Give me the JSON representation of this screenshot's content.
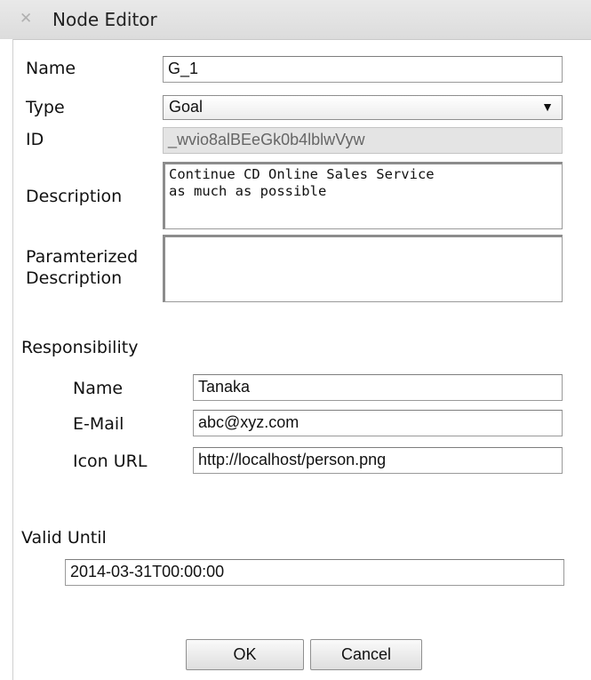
{
  "window": {
    "title": "Node Editor",
    "close_glyph": "✕"
  },
  "form": {
    "name_label": "Name",
    "name_value": "G_1",
    "type_label": "Type",
    "type_value": "Goal",
    "id_label": "ID",
    "id_value": "_wvio8alBEeGk0b4lblwVyw",
    "description_label": "Description",
    "description_value": "Continue CD Online Sales Service\nas much as possible",
    "param_label_line1": "Paramterized",
    "param_label_line2": "Description",
    "param_value": ""
  },
  "responsibility": {
    "section_label": "Responsibility",
    "name_label": "Name",
    "name_value": "Tanaka",
    "email_label": "E-Mail",
    "email_value": "abc@xyz.com",
    "icon_url_label": "Icon URL",
    "icon_url_value": "http://localhost/person.png"
  },
  "valid_until": {
    "label": "Valid Until",
    "value": "2014-03-31T00:00:00"
  },
  "buttons": {
    "ok": "OK",
    "cancel": "Cancel"
  },
  "icons": {
    "close": "close-icon",
    "dropdown": "chevron-down-icon"
  }
}
